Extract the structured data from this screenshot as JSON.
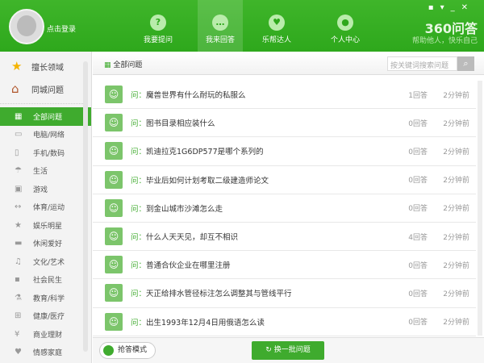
{
  "header": {
    "login": "点击登录",
    "nav": [
      {
        "label": "我要提问",
        "icon": "question-icon"
      },
      {
        "label": "我来回答",
        "icon": "chat-icon"
      },
      {
        "label": "乐帮达人",
        "icon": "handshake-icon"
      },
      {
        "label": "个人中心",
        "icon": "person-icon"
      }
    ],
    "logo": "360问答",
    "slogan": "帮助他人，快乐自己"
  },
  "sidebar": {
    "top": [
      {
        "label": "擅长领域",
        "icon": "star-icon"
      },
      {
        "label": "同城问题",
        "icon": "house-icon"
      }
    ],
    "categories": [
      {
        "label": "全部问题",
        "icon": "grid-icon"
      },
      {
        "label": "电脑/网络",
        "icon": "monitor-icon"
      },
      {
        "label": "手机/数码",
        "icon": "phone-icon"
      },
      {
        "label": "生活",
        "icon": "umbrella-icon"
      },
      {
        "label": "游戏",
        "icon": "gamepad-icon"
      },
      {
        "label": "体育/运动",
        "icon": "dumbbell-icon"
      },
      {
        "label": "娱乐明星",
        "icon": "star-icon"
      },
      {
        "label": "休闲爱好",
        "icon": "cup-icon"
      },
      {
        "label": "文化/艺术",
        "icon": "music-icon"
      },
      {
        "label": "社会民生",
        "icon": "speech-icon"
      },
      {
        "label": "教育/科学",
        "icon": "flask-icon"
      },
      {
        "label": "健康/医疗",
        "icon": "medkit-icon"
      },
      {
        "label": "商业理财",
        "icon": "yen-icon"
      },
      {
        "label": "情感家庭",
        "icon": "heart-icon"
      }
    ]
  },
  "main": {
    "title": "全部问题",
    "search_placeholder": "按关键词搜索问题",
    "q_prefix": "问：",
    "questions": [
      {
        "text": "魔兽世界有什么耐玩的私服么",
        "answers": "1回答",
        "time": "2分钟前"
      },
      {
        "text": "图书目录相应装什么",
        "answers": "0回答",
        "time": "2分钟前"
      },
      {
        "text": "凯迪拉克1G6DP577是哪个系列的",
        "answers": "0回答",
        "time": "2分钟前"
      },
      {
        "text": "毕业后如何计划考取二级建造师论文",
        "answers": "0回答",
        "time": "2分钟前"
      },
      {
        "text": "到金山城市沙滩怎么走",
        "answers": "0回答",
        "time": "2分钟前"
      },
      {
        "text": "什么人天天见，却互不相识",
        "answers": "4回答",
        "time": "2分钟前"
      },
      {
        "text": "普通合伙企业在哪里注册",
        "answers": "0回答",
        "time": "2分钟前"
      },
      {
        "text": "天正给排水管径标注怎么调整其与管线平行",
        "answers": "0回答",
        "time": "2分钟前"
      },
      {
        "text": "出生1993年12月4日用俄语怎么读",
        "answers": "0回答",
        "time": "2分钟前"
      }
    ]
  },
  "footer": {
    "mode": "抢答模式",
    "batch": "换一批问题"
  },
  "colors": {
    "brand": "#3fab2e"
  }
}
